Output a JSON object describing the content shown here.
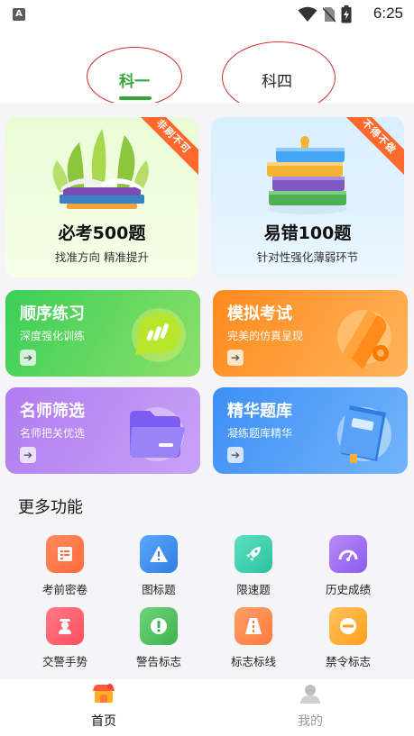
{
  "status_bar": {
    "left_badge": "A",
    "time": "6:25",
    "icons": [
      "wifi-icon",
      "no-sim-icon",
      "battery-charging-icon"
    ]
  },
  "tabs": [
    {
      "label": "科一",
      "active": true
    },
    {
      "label": "科四",
      "active": false
    }
  ],
  "big_cards": [
    {
      "title": "必考500题",
      "subtitle": "找准方向 精准提升",
      "ribbon": "非刷不可",
      "icon": "open-book-icon"
    },
    {
      "title": "易错100题",
      "subtitle": "针对性强化薄弱环节",
      "ribbon": "不得不做",
      "icon": "book-stack-icon"
    }
  ],
  "mid_cards": [
    {
      "title": "顺序练习",
      "subtitle": "深度强化训练",
      "icon": "chat-bubble-icon"
    },
    {
      "title": "模拟考试",
      "subtitle": "完美的仿真呈现",
      "icon": "scroll-icon"
    },
    {
      "title": "名师筛选",
      "subtitle": "名师把关优选",
      "icon": "folder-icon"
    },
    {
      "title": "精华题库",
      "subtitle": "凝练题库精华",
      "icon": "notebook-icon"
    }
  ],
  "more_section": {
    "title": "更多功能",
    "items": [
      {
        "label": "考前密卷",
        "icon": "exam-paper-icon",
        "color": "#ff7a45"
      },
      {
        "label": "图标题",
        "icon": "warning-triangle-icon",
        "color": "#3d8ff6"
      },
      {
        "label": "限速题",
        "icon": "rocket-icon",
        "color": "#3fcfae"
      },
      {
        "label": "历史成绩",
        "icon": "speedometer-icon",
        "color": "#a46af0"
      },
      {
        "label": "交警手势",
        "icon": "police-icon",
        "color": "#ff5f6d"
      },
      {
        "label": "警告标志",
        "icon": "exclamation-icon",
        "color": "#4cc25a"
      },
      {
        "label": "标志标线",
        "icon": "road-icon",
        "color": "#ff8a3d"
      },
      {
        "label": "禁令标志",
        "icon": "no-entry-icon",
        "color": "#ffa733"
      }
    ]
  },
  "bottom_nav": [
    {
      "label": "首页",
      "icon": "shop-icon",
      "active": true
    },
    {
      "label": "我的",
      "icon": "user-icon",
      "active": false
    }
  ],
  "colors": {
    "accent_green": "#34a83a",
    "ribbon_orange": "#ff6a2c",
    "annotation_red": "#d22a2a"
  }
}
